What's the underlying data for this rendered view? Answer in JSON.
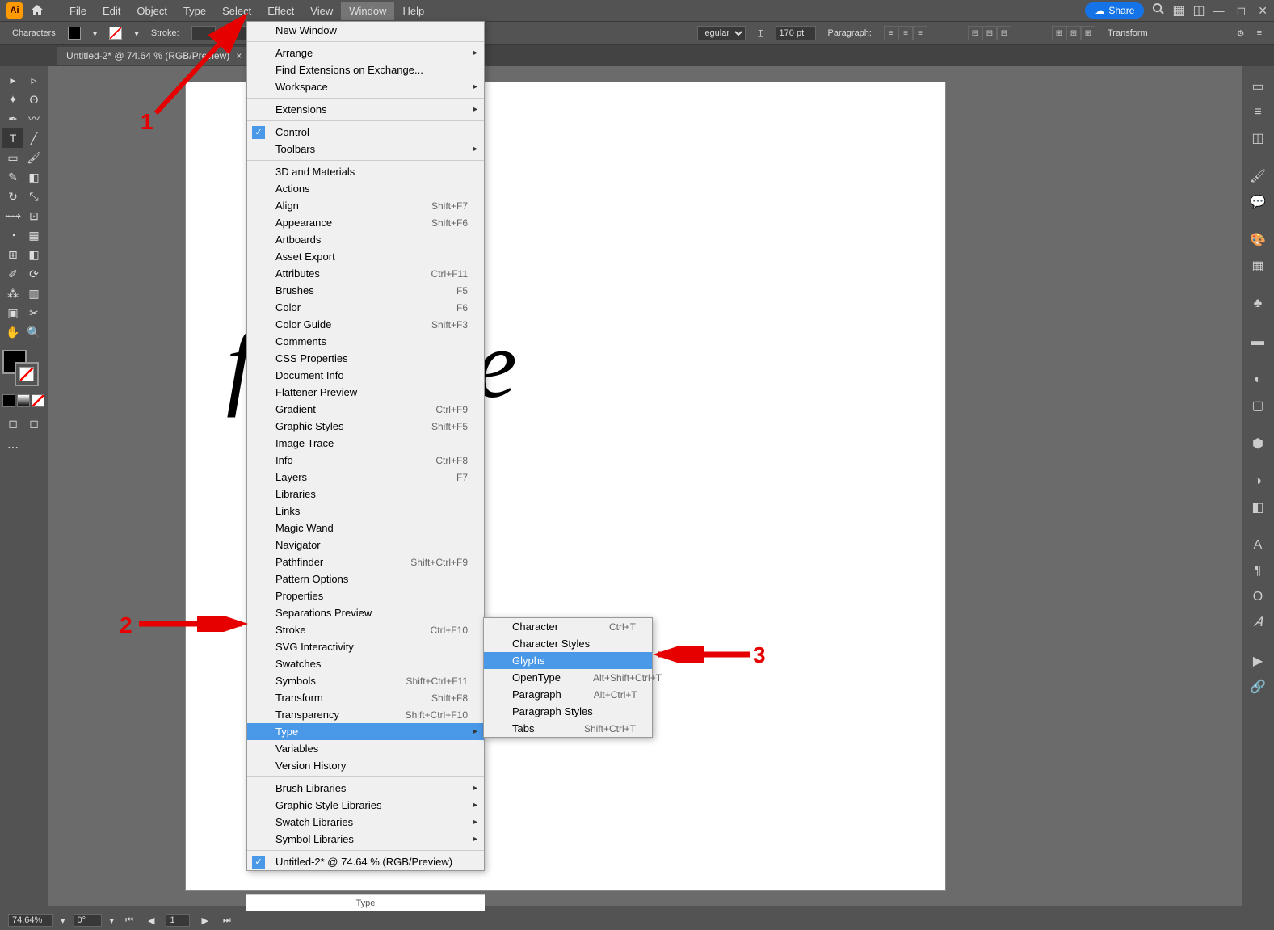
{
  "menubar": {
    "items": [
      "File",
      "Edit",
      "Object",
      "Type",
      "Select",
      "Effect",
      "View",
      "Window",
      "Help"
    ],
    "active_index": 7
  },
  "share_label": "Share",
  "control_bar": {
    "left_label": "Characters",
    "stroke_label": "Stroke:",
    "style_value": "egular",
    "font_size": "170 pt",
    "paragraph_label": "Paragraph:",
    "transform_label": "Transform"
  },
  "doc_tab": "Untitled-2* @ 74.64 % (RGB/Preview)",
  "canvas_text": "f           dles.ne",
  "window_menu": [
    {
      "label": "New Window"
    },
    {
      "sep": true
    },
    {
      "label": "Arrange",
      "sub": true
    },
    {
      "label": "Find Extensions on Exchange..."
    },
    {
      "label": "Workspace",
      "sub": true
    },
    {
      "sep": true
    },
    {
      "label": "Extensions",
      "sub": true
    },
    {
      "sep": true
    },
    {
      "label": "Control",
      "check": true
    },
    {
      "label": "Toolbars",
      "sub": true
    },
    {
      "sep": true
    },
    {
      "label": "3D and Materials"
    },
    {
      "label": "Actions"
    },
    {
      "label": "Align",
      "shortcut": "Shift+F7"
    },
    {
      "label": "Appearance",
      "shortcut": "Shift+F6"
    },
    {
      "label": "Artboards"
    },
    {
      "label": "Asset Export"
    },
    {
      "label": "Attributes",
      "shortcut": "Ctrl+F11"
    },
    {
      "label": "Brushes",
      "shortcut": "F5"
    },
    {
      "label": "Color",
      "shortcut": "F6"
    },
    {
      "label": "Color Guide",
      "shortcut": "Shift+F3"
    },
    {
      "label": "Comments"
    },
    {
      "label": "CSS Properties"
    },
    {
      "label": "Document Info"
    },
    {
      "label": "Flattener Preview"
    },
    {
      "label": "Gradient",
      "shortcut": "Ctrl+F9"
    },
    {
      "label": "Graphic Styles",
      "shortcut": "Shift+F5"
    },
    {
      "label": "Image Trace"
    },
    {
      "label": "Info",
      "shortcut": "Ctrl+F8"
    },
    {
      "label": "Layers",
      "shortcut": "F7"
    },
    {
      "label": "Libraries"
    },
    {
      "label": "Links"
    },
    {
      "label": "Magic Wand"
    },
    {
      "label": "Navigator"
    },
    {
      "label": "Pathfinder",
      "shortcut": "Shift+Ctrl+F9"
    },
    {
      "label": "Pattern Options"
    },
    {
      "label": "Properties"
    },
    {
      "label": "Separations Preview"
    },
    {
      "label": "Stroke",
      "shortcut": "Ctrl+F10"
    },
    {
      "label": "SVG Interactivity"
    },
    {
      "label": "Swatches"
    },
    {
      "label": "Symbols",
      "shortcut": "Shift+Ctrl+F11"
    },
    {
      "label": "Transform",
      "shortcut": "Shift+F8"
    },
    {
      "label": "Transparency",
      "shortcut": "Shift+Ctrl+F10"
    },
    {
      "label": "Type",
      "sub": true,
      "hover": true
    },
    {
      "label": "Variables"
    },
    {
      "label": "Version History"
    },
    {
      "sep": true
    },
    {
      "label": "Brush Libraries",
      "sub": true
    },
    {
      "label": "Graphic Style Libraries",
      "sub": true
    },
    {
      "label": "Swatch Libraries",
      "sub": true
    },
    {
      "label": "Symbol Libraries",
      "sub": true
    },
    {
      "sep": true
    },
    {
      "label": "Untitled-2* @ 74.64 % (RGB/Preview)",
      "check": true
    }
  ],
  "type_submenu": [
    {
      "label": "Character",
      "shortcut": "Ctrl+T"
    },
    {
      "label": "Character Styles"
    },
    {
      "label": "Glyphs",
      "hover": true
    },
    {
      "label": "OpenType",
      "shortcut": "Alt+Shift+Ctrl+T"
    },
    {
      "label": "Paragraph",
      "shortcut": "Alt+Ctrl+T"
    },
    {
      "label": "Paragraph Styles"
    },
    {
      "label": "Tabs",
      "shortcut": "Shift+Ctrl+T"
    }
  ],
  "annotations": {
    "a1": "1",
    "a2": "2",
    "a3": "3"
  },
  "status": {
    "zoom": "74.64%",
    "angle": "0°",
    "page": "1"
  },
  "bottom_info_label": "Type"
}
